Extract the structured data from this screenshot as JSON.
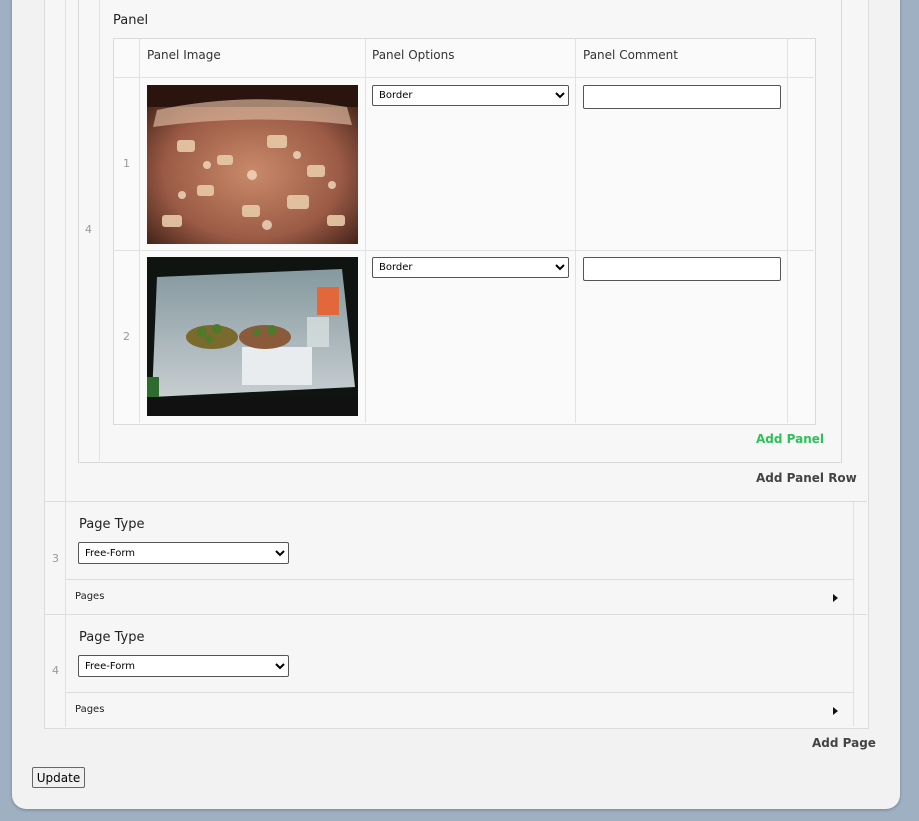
{
  "panel_section": {
    "title": "Panel",
    "row_number": "4",
    "columns": [
      "Panel Image",
      "Panel Options",
      "Panel Comment"
    ],
    "panels": [
      {
        "index": "1",
        "image_icon": "baked-crumble-photo",
        "option": "Border",
        "comment": ""
      },
      {
        "index": "2",
        "image_icon": "terrarium-plants-photo",
        "option": "Border",
        "comment": ""
      }
    ],
    "add_panel_label": "Add Panel",
    "add_panel_row_label": "Add Panel Row"
  },
  "pages": [
    {
      "index": "3",
      "page_type_label": "Page Type",
      "page_type_value": "Free-Form",
      "pages_label": "Pages"
    },
    {
      "index": "4",
      "page_type_label": "Page Type",
      "page_type_value": "Free-Form",
      "pages_label": "Pages"
    }
  ],
  "add_page_label": "Add Page",
  "update_label": "Update",
  "colors": {
    "add_panel": "#2ec05a",
    "background": "#9fb0c3",
    "card": "#f2f2f2"
  }
}
